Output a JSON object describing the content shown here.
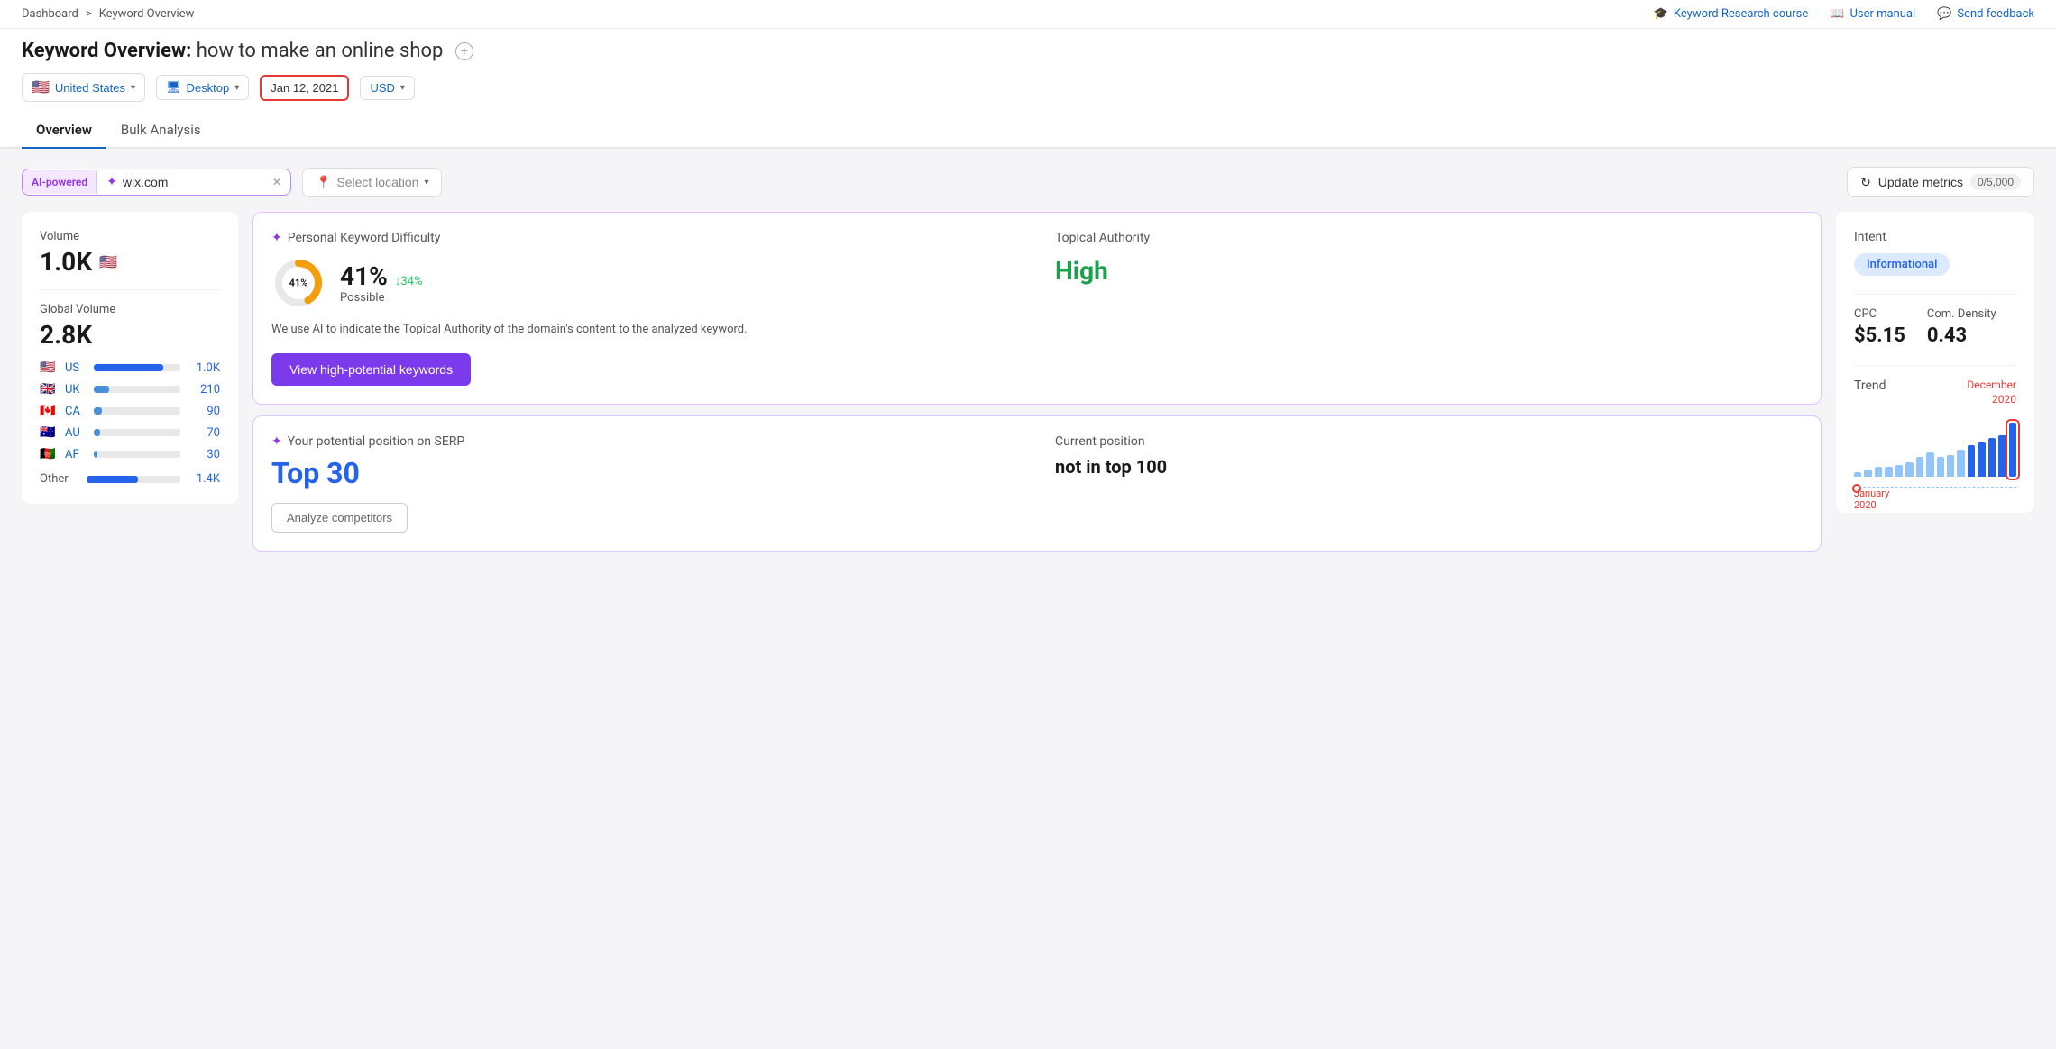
{
  "topbar": {
    "breadcrumb_home": "Dashboard",
    "breadcrumb_sep": ">",
    "breadcrumb_current": "Keyword Overview",
    "nav_course": "Keyword Research course",
    "nav_manual": "User manual",
    "nav_feedback": "Send feedback"
  },
  "page": {
    "title_label": "Keyword Overview:",
    "title_keyword": "how to make an online shop",
    "add_icon": "+"
  },
  "filters": {
    "country": "United States",
    "device": "Desktop",
    "date": "Jan 12, 2021",
    "currency": "USD"
  },
  "tabs": {
    "overview": "Overview",
    "bulk": "Bulk Analysis"
  },
  "search_bar": {
    "ai_label": "AI-powered",
    "input_value": "wix.com",
    "location_placeholder": "Select location",
    "update_label": "Update metrics",
    "update_count": "0/5,000"
  },
  "left_panel": {
    "volume_label": "Volume",
    "volume_value": "1.0K",
    "global_volume_label": "Global Volume",
    "global_volume_value": "2.8K",
    "countries": [
      {
        "code": "US",
        "flag": "🇺🇸",
        "value": "1.0K",
        "bar_pct": 80
      },
      {
        "code": "UK",
        "flag": "🇬🇧",
        "value": "210",
        "bar_pct": 18
      },
      {
        "code": "CA",
        "flag": "🇨🇦",
        "value": "90",
        "bar_pct": 9
      },
      {
        "code": "AU",
        "flag": "🇦🇺",
        "value": "70",
        "bar_pct": 7
      },
      {
        "code": "AF",
        "flag": "🇦🇫",
        "value": "30",
        "bar_pct": 4
      }
    ],
    "other_label": "Other",
    "other_value": "1.4K"
  },
  "pkd_card": {
    "header": "Personal Keyword Difficulty",
    "donut_pct": 41,
    "pct_label": "41%",
    "change": "↓34%",
    "possible": "Possible",
    "ta_header": "Topical Authority",
    "ta_value": "High",
    "description": "We use AI to indicate the Topical Authority of the domain's content to the analyzed keyword.",
    "button": "View high-potential keywords"
  },
  "serp_card": {
    "potential_header": "Your potential position on SERP",
    "potential_value": "Top 30",
    "current_header": "Current position",
    "current_value": "not in top 100",
    "analyze_btn": "Analyze competitors"
  },
  "right_panel": {
    "intent_label": "Intent",
    "intent_value": "Informational",
    "cpc_label": "CPC",
    "cpc_value": "$5.15",
    "density_label": "Com. Density",
    "density_value": "0.43",
    "trend_label": "Trend",
    "trend_dec_label": "December",
    "trend_dec_year": "2020",
    "trend_jan_label": "January",
    "trend_jan_year": "2020",
    "trend_bars": [
      2,
      3,
      4,
      4,
      5,
      6,
      8,
      10,
      8,
      9,
      11,
      13,
      14,
      16,
      17,
      22
    ]
  }
}
